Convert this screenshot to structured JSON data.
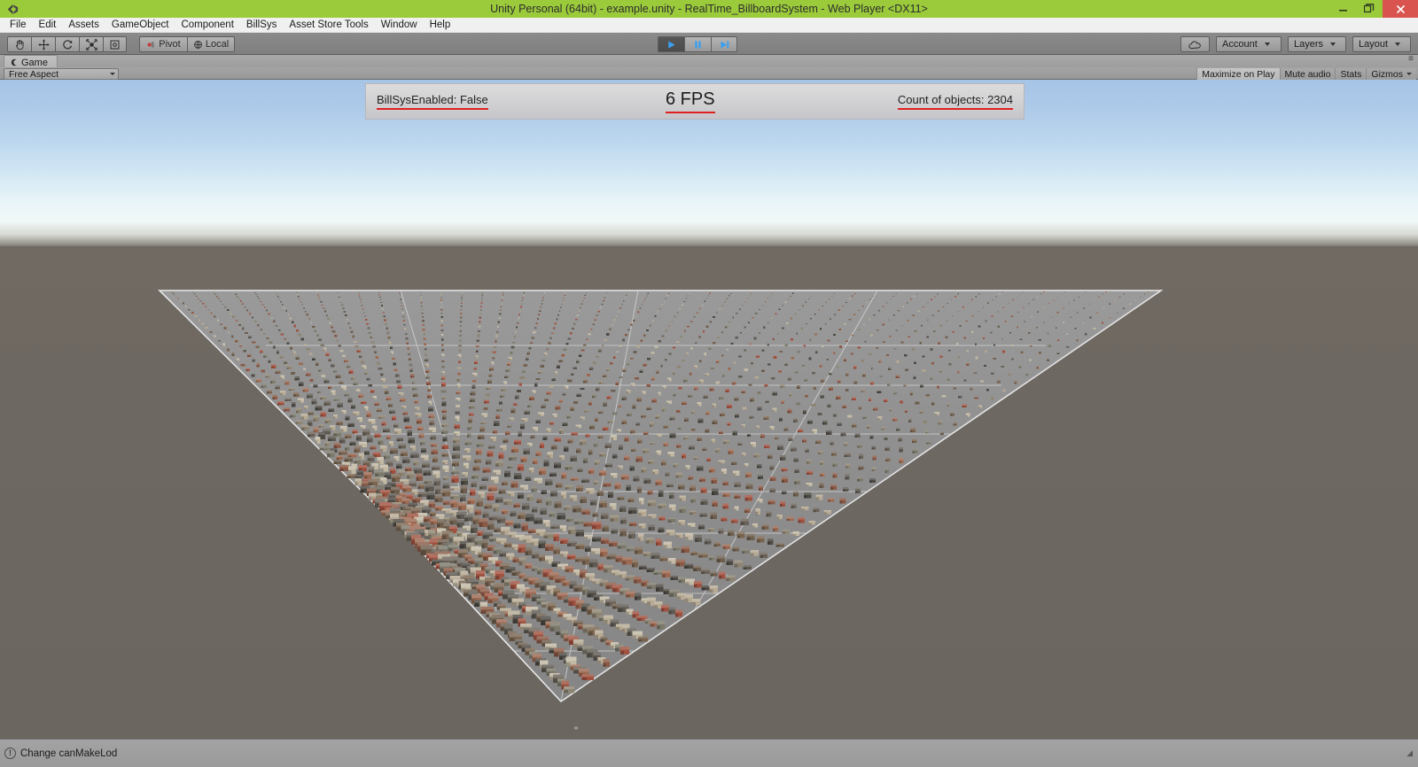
{
  "window": {
    "title": "Unity Personal (64bit) - example.unity - RealTime_BillboardSystem - Web Player <DX11>",
    "logo_icon": "unity-logo-icon",
    "controls": [
      {
        "name": "minimize-button",
        "glyph": "–"
      },
      {
        "name": "restore-button",
        "glyph": "❐"
      },
      {
        "name": "close-button",
        "glyph": "✕"
      }
    ],
    "titlebar_color": "#9bcb3b",
    "close_color": "#d9534f"
  },
  "menubar": {
    "items": [
      {
        "label": "File"
      },
      {
        "label": "Edit"
      },
      {
        "label": "Assets"
      },
      {
        "label": "GameObject"
      },
      {
        "label": "Component"
      },
      {
        "label": "BillSys"
      },
      {
        "label": "Asset Store Tools"
      },
      {
        "label": "Window"
      },
      {
        "label": "Help"
      }
    ]
  },
  "toolbar": {
    "tools": [
      {
        "name": "hand-tool-button",
        "icon": "hand-icon"
      },
      {
        "name": "move-tool-button",
        "icon": "move-arrows-icon"
      },
      {
        "name": "rotate-tool-button",
        "icon": "rotate-icon"
      },
      {
        "name": "scale-tool-button",
        "icon": "scale-icon"
      },
      {
        "name": "rect-tool-button",
        "icon": "rect-transform-icon"
      }
    ],
    "pivot_label": "Pivot",
    "pivot_icon": "pivot-icon",
    "local_label": "Local",
    "local_icon": "globe-local-icon",
    "playback": [
      {
        "name": "play-button",
        "icon": "play-icon",
        "active": true
      },
      {
        "name": "pause-button",
        "icon": "pause-icon",
        "active": false
      },
      {
        "name": "step-button",
        "icon": "step-forward-icon",
        "active": false
      }
    ],
    "cloud_icon": "cloud-icon",
    "account_label": "Account",
    "layers_label": "Layers",
    "layout_label": "Layout"
  },
  "view": {
    "tab_label": "Game",
    "tab_icon": "game-view-icon",
    "aspect_label": "Free Aspect",
    "buttons": [
      {
        "name": "maximize-on-play-button",
        "label": "Maximize on Play",
        "pressed": true
      },
      {
        "name": "mute-audio-button",
        "label": "Mute audio",
        "pressed": false
      },
      {
        "name": "stats-button",
        "label": "Stats",
        "pressed": false
      },
      {
        "name": "gizmos-button",
        "label": "Gizmos",
        "pressed": false
      }
    ]
  },
  "overlay": {
    "billsys_label": "BillSysEnabled: False",
    "fps_label": "6 FPS",
    "count_label": "Count of objects: 2304",
    "underline_color": "#e02020"
  },
  "statusbar": {
    "icon": "info-circle-icon",
    "message": "Change canMakeLod"
  },
  "scene": {
    "sky_top_color": "#a6c4e6",
    "sky_horizon_color": "#f2f8f8",
    "ground_color": "#6e6862",
    "plane_color": "#8d8d8d",
    "grid_line_color": "#d8d8d8"
  }
}
